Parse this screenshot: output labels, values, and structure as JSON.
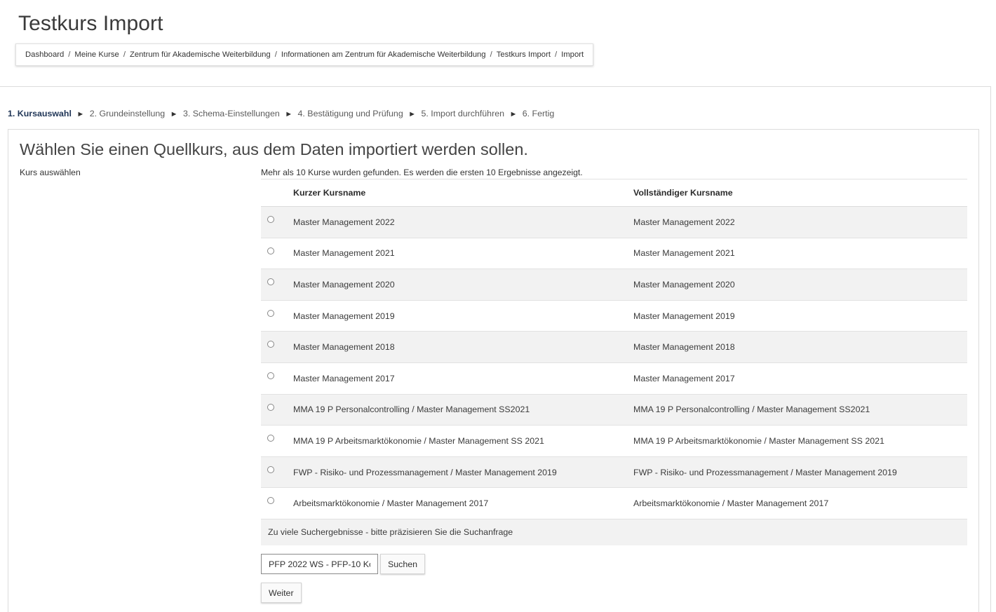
{
  "page": {
    "title": "Testkurs Import"
  },
  "breadcrumb": [
    "Dashboard",
    "Meine Kurse",
    "Zentrum für Akademische Weiterbildung",
    "Informationen am Zentrum für Akademische Weiterbildung",
    "Testkurs Import",
    "Import"
  ],
  "breadcrumb_separator": "/",
  "steps": {
    "arrow": "►",
    "items": [
      "1. Kursauswahl",
      "2. Grundeinstellung",
      "3. Schema-Einstellungen",
      "4. Bestätigung und Prüfung",
      "5. Import durchführen",
      "6. Fertig"
    ],
    "active_index": 0
  },
  "section": {
    "title": "Wählen Sie einen Quellkurs, aus dem Daten importiert werden sollen.",
    "label": "Kurs auswählen",
    "info": "Mehr als 10 Kurse wurden gefunden. Es werden die ersten 10 Ergebnisse angezeigt."
  },
  "table": {
    "headers": {
      "short": "Kurzer Kursname",
      "full": "Vollständiger Kursname"
    },
    "rows": [
      {
        "short": "Master Management 2022",
        "full": "Master Management 2022"
      },
      {
        "short": "Master Management 2021",
        "full": "Master Management 2021"
      },
      {
        "short": "Master Management 2020",
        "full": "Master Management 2020"
      },
      {
        "short": "Master Management 2019",
        "full": "Master Management 2019"
      },
      {
        "short": "Master Management 2018",
        "full": "Master Management 2018"
      },
      {
        "short": "Master Management 2017",
        "full": "Master Management 2017"
      },
      {
        "short": "MMA 19 P Personalcontrolling / Master Management SS2021",
        "full": "MMA 19 P Personalcontrolling / Master Management SS2021"
      },
      {
        "short": "MMA 19 P Arbeitsmarktökonomie / Master Management SS 2021",
        "full": "MMA 19 P Arbeitsmarktökonomie / Master Management SS 2021"
      },
      {
        "short": "FWP - Risiko- und Prozessmanagement / Master Management 2019",
        "full": "FWP - Risiko- und Prozessmanagement / Master Management 2019"
      },
      {
        "short": "Arbeitsmarktökonomie / Master Management 2017",
        "full": "Arbeitsmarktökonomie / Master Management 2017"
      }
    ],
    "footer": "Zu viele Suchergebnisse - bitte präzisieren Sie die Suchanfrage"
  },
  "search": {
    "value": "PFP 2022 WS - PFP-10 Ko",
    "button_label": "Suchen"
  },
  "next_button_label": "Weiter"
}
